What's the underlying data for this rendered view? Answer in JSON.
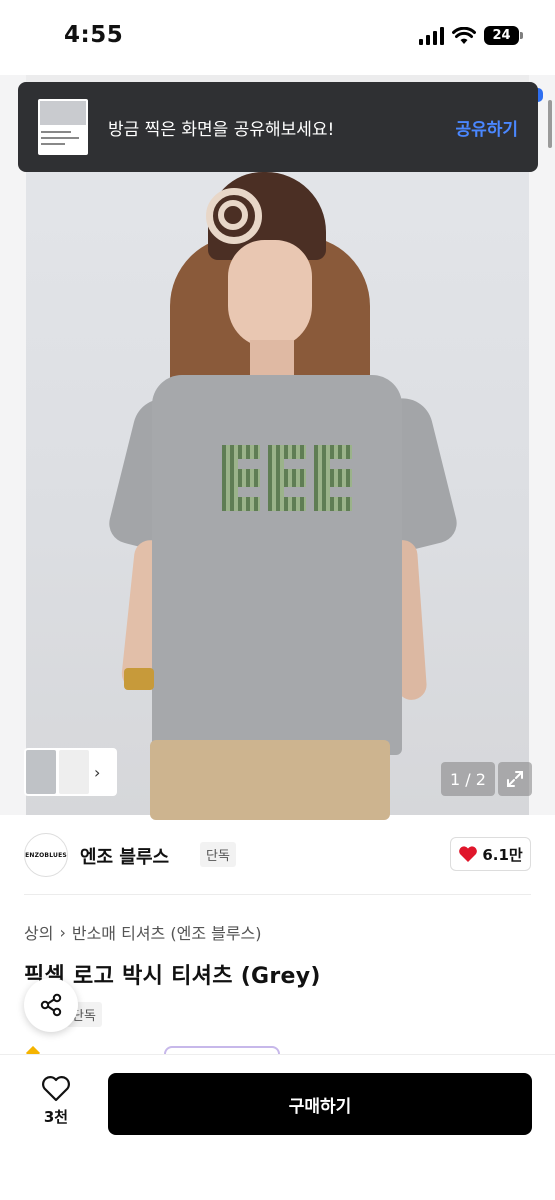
{
  "status_bar": {
    "time": "4:55",
    "battery": "24"
  },
  "toast": {
    "message": "방금 찍은 화면을 공유해보세요!",
    "action": "공유하기"
  },
  "gallery": {
    "counter": "1 / 2"
  },
  "brand": {
    "logo_text": "ENZOBLUES",
    "name": "엔조 블루스",
    "badge": "단독",
    "likes": "6.1만"
  },
  "breadcrumb": {
    "items": [
      "상의",
      "반소매 티셔츠 (엔조 블루스)"
    ]
  },
  "product": {
    "title": "픽셀 로고 박시 티셔츠 (Grey)",
    "tag": "단독"
  },
  "bottom_bar": {
    "wish_count": "3천",
    "buy_label": "구매하기"
  },
  "colors": {
    "accent": "#4a87ff",
    "heart": "#e0162b",
    "buy_bg": "#000000",
    "toast_bg": "#2f3033"
  },
  "icons": [
    "signal-icon",
    "wifi-icon",
    "battery-icon",
    "expand-icon",
    "heart-icon",
    "share-icon",
    "chevron-right-icon"
  ]
}
